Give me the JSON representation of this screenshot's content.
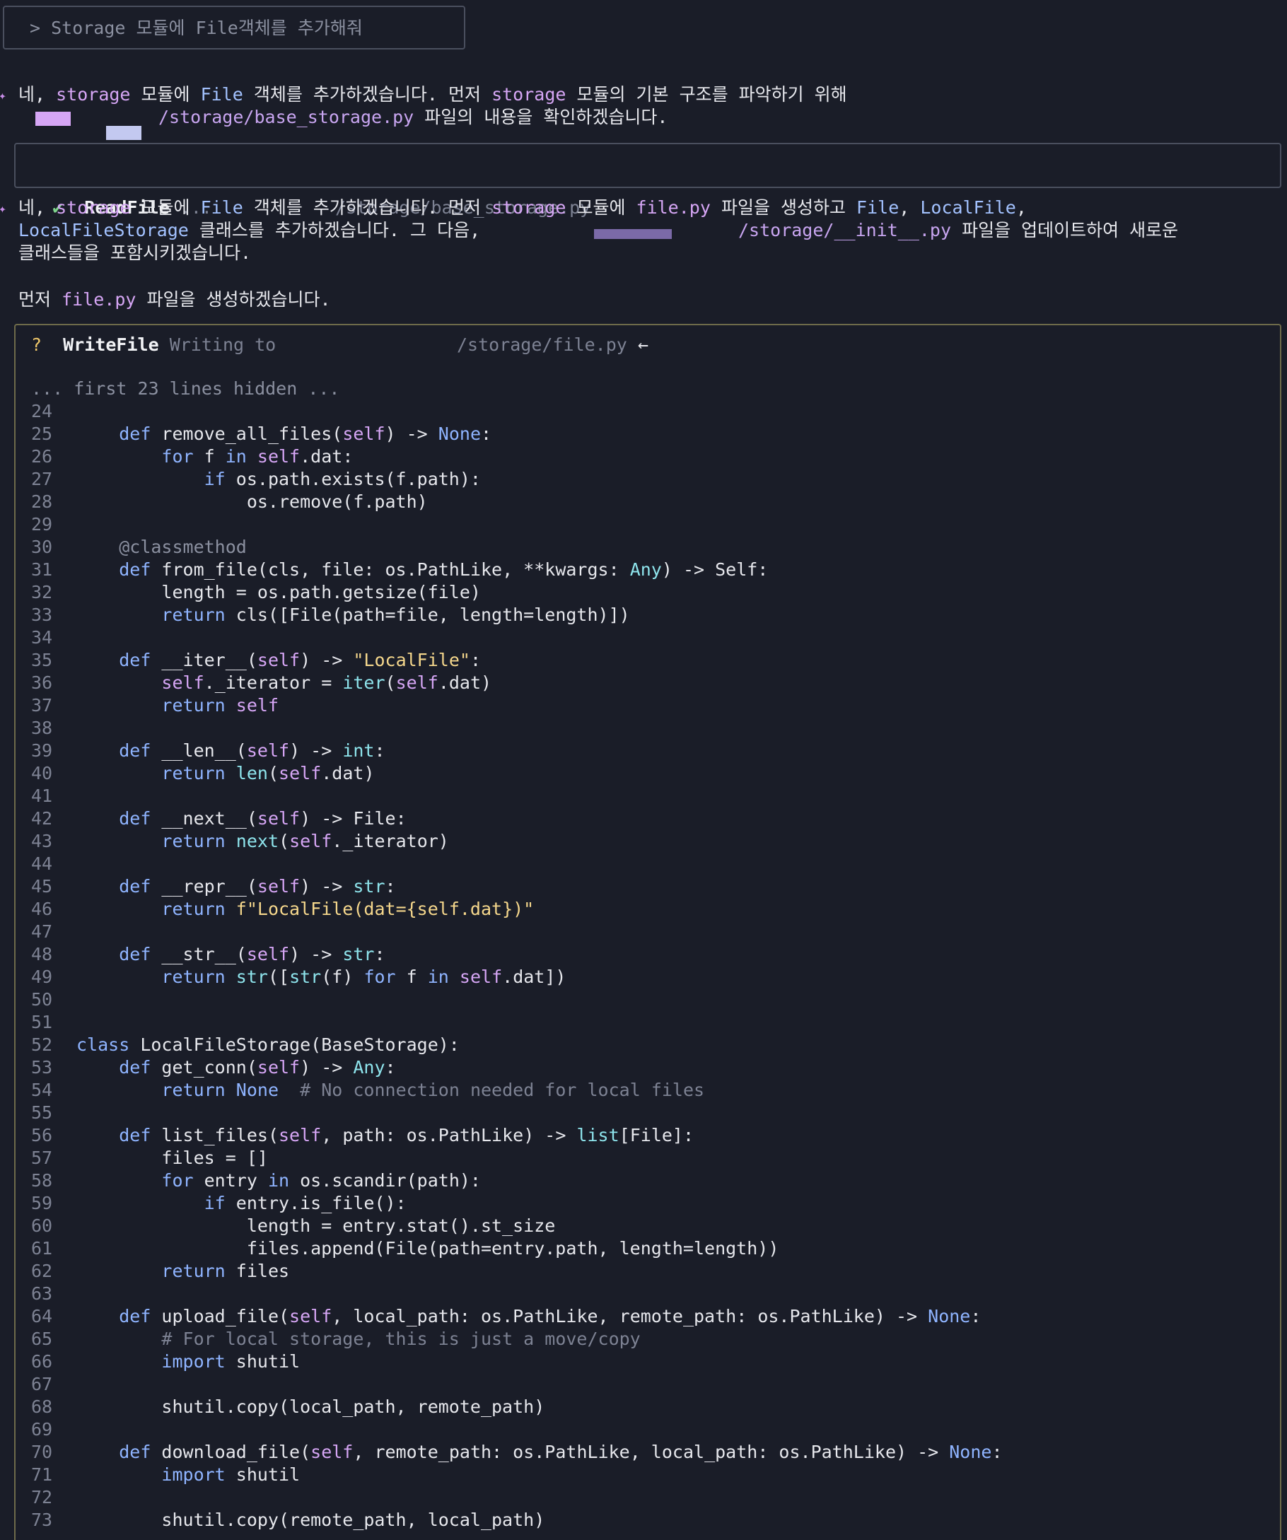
{
  "prompt": "> Storage 모듈에 File객체를 추가해줘",
  "message1": {
    "p1": "네, ",
    "t1": "storage",
    "p2": " 모듈에 ",
    "t2": "File",
    "p3": " 객체를 추가하겠습니다. 먼저 ",
    "t3": "storage",
    "p4": " 모듈의 기본 구조를 파악하기 위해",
    "path": "/storage/base_storage.py",
    "p5": " 파일의 내용을 확인하겠습니다."
  },
  "readfile": {
    "check": "✔",
    "name": "ReadFile",
    "dots": "...",
    "path": "/storage/base_storage.py"
  },
  "message2": {
    "p1": "네, ",
    "t1": "storage",
    "p2": " 모듈에 ",
    "t2": "File",
    "p3": " 객체를 추가하겠습니다. 먼저 ",
    "t3": "storage",
    "p4": " 모듈에 ",
    "t4": "file.py",
    "p5": " 파일을 생성하고 ",
    "t5": "File",
    "p6": ", ",
    "t6": "LocalFile",
    "p7": ",",
    "t7": "LocalFileStorage",
    "p8": " 클래스를 추가하겠습니다. 그 다음,",
    "path": "/storage/__init__.py",
    "p9": " 파일을 업데이트하여 새로운",
    "p10": "클래스들을 포함시키겠습니다."
  },
  "message3": {
    "p1": "먼저 ",
    "t1": "file.py",
    "p2": " 파일을 생성하겠습니다."
  },
  "writefile": {
    "q": "?",
    "name": "WriteFile",
    "action": "Writing to",
    "path": "/storage/file.py",
    "arrow": "←",
    "hidden_note": "... first 23 lines hidden ..."
  },
  "code_lines": [
    {
      "n": "24",
      "code": ""
    },
    {
      "n": "25",
      "code": "    def remove_all_files(self) -> None:"
    },
    {
      "n": "26",
      "code": "        for f in self.dat:"
    },
    {
      "n": "27",
      "code": "            if os.path.exists(f.path):"
    },
    {
      "n": "28",
      "code": "                os.remove(f.path)"
    },
    {
      "n": "29",
      "code": ""
    },
    {
      "n": "30",
      "code": "    @classmethod"
    },
    {
      "n": "31",
      "code": "    def from_file(cls, file: os.PathLike, **kwargs: Any) -> Self:"
    },
    {
      "n": "32",
      "code": "        length = os.path.getsize(file)"
    },
    {
      "n": "33",
      "code": "        return cls([File(path=file, length=length)])"
    },
    {
      "n": "34",
      "code": ""
    },
    {
      "n": "35",
      "code": "    def __iter__(self) -> \"LocalFile\":"
    },
    {
      "n": "36",
      "code": "        self._iterator = iter(self.dat)"
    },
    {
      "n": "37",
      "code": "        return self"
    },
    {
      "n": "38",
      "code": ""
    },
    {
      "n": "39",
      "code": "    def __len__(self) -> int:"
    },
    {
      "n": "40",
      "code": "        return len(self.dat)"
    },
    {
      "n": "41",
      "code": ""
    },
    {
      "n": "42",
      "code": "    def __next__(self) -> File:"
    },
    {
      "n": "43",
      "code": "        return next(self._iterator)"
    },
    {
      "n": "44",
      "code": ""
    },
    {
      "n": "45",
      "code": "    def __repr__(self) -> str:"
    },
    {
      "n": "46",
      "code": "        return f\"LocalFile(dat={self.dat})\""
    },
    {
      "n": "47",
      "code": ""
    },
    {
      "n": "48",
      "code": "    def __str__(self) -> str:"
    },
    {
      "n": "49",
      "code": "        return str([str(f) for f in self.dat])"
    },
    {
      "n": "50",
      "code": ""
    },
    {
      "n": "51",
      "code": ""
    },
    {
      "n": "52",
      "code": "class LocalFileStorage(BaseStorage):"
    },
    {
      "n": "53",
      "code": "    def get_conn(self) -> Any:"
    },
    {
      "n": "54",
      "code": "        return None  # No connection needed for local files"
    },
    {
      "n": "55",
      "code": ""
    },
    {
      "n": "56",
      "code": "    def list_files(self, path: os.PathLike) -> list[File]:"
    },
    {
      "n": "57",
      "code": "        files = []"
    },
    {
      "n": "58",
      "code": "        for entry in os.scandir(path):"
    },
    {
      "n": "59",
      "code": "            if entry.is_file():"
    },
    {
      "n": "60",
      "code": "                length = entry.stat().st_size"
    },
    {
      "n": "61",
      "code": "                files.append(File(path=entry.path, length=length))"
    },
    {
      "n": "62",
      "code": "        return files"
    },
    {
      "n": "63",
      "code": ""
    },
    {
      "n": "64",
      "code": "    def upload_file(self, local_path: os.PathLike, remote_path: os.PathLike) -> None:"
    },
    {
      "n": "65",
      "code": "        # For local storage, this is just a move/copy"
    },
    {
      "n": "66",
      "code": "        import shutil"
    },
    {
      "n": "67",
      "code": ""
    },
    {
      "n": "68",
      "code": "        shutil.copy(local_path, remote_path)"
    },
    {
      "n": "69",
      "code": ""
    },
    {
      "n": "70",
      "code": "    def download_file(self, remote_path: os.PathLike, local_path: os.PathLike) -> None:"
    },
    {
      "n": "71",
      "code": "        import shutil"
    },
    {
      "n": "72",
      "code": ""
    },
    {
      "n": "73",
      "code": "        shutil.copy(remote_path, local_path)"
    }
  ]
}
